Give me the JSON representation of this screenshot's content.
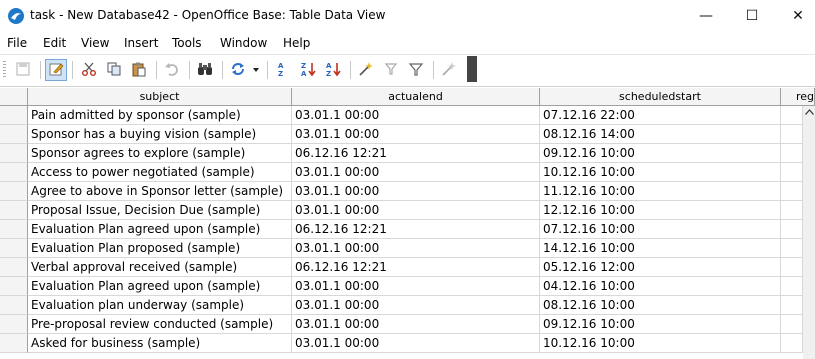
{
  "window": {
    "title": "task - New Database42 - OpenOffice Base: Table Data View",
    "minimize_glyph": "—",
    "maximize_glyph": "☐",
    "close_glyph": "✕"
  },
  "menu": [
    {
      "label": "File"
    },
    {
      "label": "Edit"
    },
    {
      "label": "View"
    },
    {
      "label": "Insert"
    },
    {
      "label": "Tools"
    },
    {
      "label": "Window"
    },
    {
      "label": "Help"
    }
  ],
  "toolbar": {
    "icons": [
      "save-icon",
      "edit-data-icon",
      "cut-icon",
      "copy-icon",
      "paste-icon",
      "undo-icon",
      "find-record-icon",
      "refresh-icon",
      "sort-ascending-icon",
      "sort-descending-icon",
      "sort-icon",
      "autofilter-icon",
      "standard-filter-icon",
      "apply-filter-icon",
      "remove-filter-icon"
    ]
  },
  "table": {
    "columns": [
      "subject",
      "actualend",
      "scheduledstart",
      "reg"
    ],
    "rows": [
      [
        "Pain admitted by sponsor (sample)",
        "03.01.1 00:00",
        "07.12.16 22:00"
      ],
      [
        "Sponsor has a buying vision (sample)",
        "03.01.1 00:00",
        "08.12.16 14:00"
      ],
      [
        "Sponsor agrees to explore (sample)",
        "06.12.16 12:21",
        "09.12.16 10:00"
      ],
      [
        "Access to power negotiated (sample)",
        "03.01.1 00:00",
        "10.12.16 10:00"
      ],
      [
        "Agree to above in Sponsor letter (sample)",
        "03.01.1 00:00",
        "11.12.16 10:00"
      ],
      [
        "Proposal Issue, Decision Due (sample)",
        "03.01.1 00:00",
        "12.12.16 10:00"
      ],
      [
        "Evaluation Plan agreed upon (sample)",
        "06.12.16 12:21",
        "07.12.16 10:00"
      ],
      [
        "Evaluation Plan proposed (sample)",
        "03.01.1 00:00",
        "14.12.16 10:00"
      ],
      [
        "Verbal approval received (sample)",
        "06.12.16 12:21",
        "05.12.16 12:00"
      ],
      [
        "Evaluation Plan agreed upon (sample)",
        "03.01.1 00:00",
        "04.12.16 10:00"
      ],
      [
        "Evaluation plan underway (sample)",
        "03.01.1 00:00",
        "08.12.16 10:00"
      ],
      [
        "Pre-proposal review conducted (sample)",
        "03.01.1 00:00",
        "09.12.16 10:00"
      ],
      [
        "Asked for business (sample)",
        "03.01.1 00:00",
        "10.12.16 10:00"
      ]
    ]
  }
}
